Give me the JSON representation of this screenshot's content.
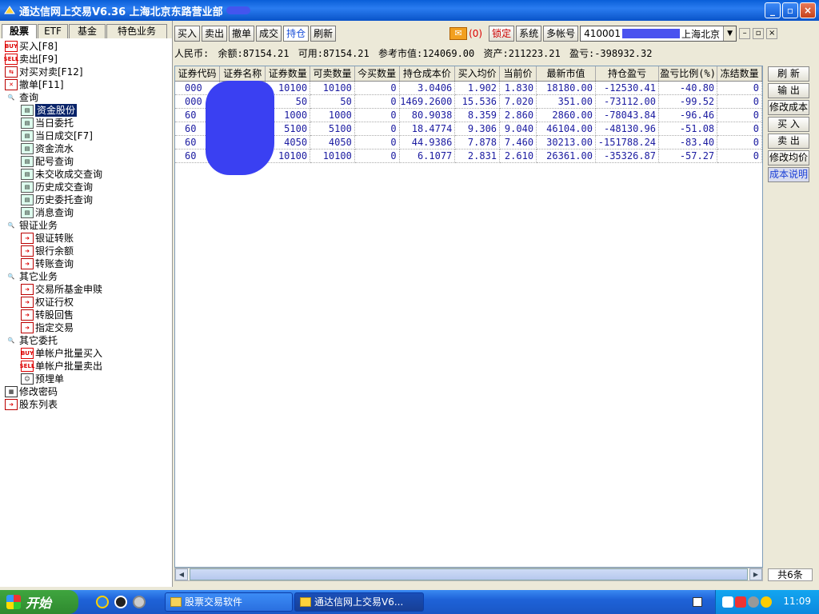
{
  "window": {
    "title": "通达信网上交易V6.36 上海北京东路营业部",
    "min": "_",
    "max": "▫",
    "close": "×"
  },
  "nav": {
    "tabs": [
      "股票",
      "ETF",
      "基金",
      "特色业务"
    ],
    "items": [
      {
        "label": "买入[F8]",
        "icon": "buy-icon",
        "indent": 0
      },
      {
        "label": "卖出[F9]",
        "icon": "sell-icon",
        "indent": 0
      },
      {
        "label": "对买对卖[F12]",
        "icon": "trade-icon",
        "indent": 0
      },
      {
        "label": "撤单[F11]",
        "icon": "cancel-order-icon",
        "indent": 0
      },
      {
        "label": "查询",
        "icon": "search-icon",
        "indent": 0
      },
      {
        "label": "资金股份",
        "icon": "query-icon",
        "indent": 1,
        "selected": true
      },
      {
        "label": "当日委托",
        "icon": "query-icon",
        "indent": 1
      },
      {
        "label": "当日成交[F7]",
        "icon": "query-icon",
        "indent": 1
      },
      {
        "label": "资金流水",
        "icon": "query-icon",
        "indent": 1
      },
      {
        "label": "配号查询",
        "icon": "query-icon",
        "indent": 1
      },
      {
        "label": "未交收成交查询",
        "icon": "query-icon",
        "indent": 1
      },
      {
        "label": "历史成交查询",
        "icon": "query-icon",
        "indent": 1
      },
      {
        "label": "历史委托查询",
        "icon": "query-icon",
        "indent": 1
      },
      {
        "label": "消息查询",
        "icon": "query-icon",
        "indent": 1
      },
      {
        "label": "银证业务",
        "icon": "search-icon",
        "indent": 0
      },
      {
        "label": "银证转账",
        "icon": "arrow-icon",
        "indent": 1
      },
      {
        "label": "银行余额",
        "icon": "arrow-icon",
        "indent": 1
      },
      {
        "label": "转账查询",
        "icon": "arrow-icon",
        "indent": 1
      },
      {
        "label": "其它业务",
        "icon": "search-icon",
        "indent": 0
      },
      {
        "label": "交易所基金申赎",
        "icon": "arrow-icon",
        "indent": 1
      },
      {
        "label": "权证行权",
        "icon": "arrow-icon",
        "indent": 1
      },
      {
        "label": "转股回售",
        "icon": "arrow-icon",
        "indent": 1
      },
      {
        "label": "指定交易",
        "icon": "arrow-icon",
        "indent": 1
      },
      {
        "label": "其它委托",
        "icon": "search-icon",
        "indent": 0
      },
      {
        "label": "单帐户批量买入",
        "icon": "buy-icon",
        "indent": 1
      },
      {
        "label": "单帐户批量卖出",
        "icon": "sell-icon",
        "indent": 1
      },
      {
        "label": "预埋单",
        "icon": "user-icon",
        "indent": 1
      },
      {
        "label": "修改密码",
        "icon": "key-icon",
        "indent": 0
      },
      {
        "label": "股东列表",
        "icon": "arrow-icon",
        "indent": 0
      }
    ]
  },
  "toolbar": {
    "buttons": [
      "买入",
      "卖出",
      "撤单",
      "成交",
      "持仓",
      "刷新"
    ],
    "active": "持仓",
    "mail_count": "(0)",
    "lock": "锁定",
    "system": "系统",
    "multi_account": "多帐号",
    "account_prefix": "410001",
    "account_suffix": "上海北京",
    "account_dd": "▼"
  },
  "summary": {
    "currency": "人民币:",
    "balance": "余额:87154.21",
    "available": "可用:87154.21",
    "market_value": "参考市值:124069.00",
    "assets": "资产:211223.21",
    "pnl": "盈亏:-398932.32"
  },
  "table": {
    "columns": [
      "证券代码",
      "证券名称",
      "证券数量",
      "可卖数量",
      "今买数量",
      "持仓成本价",
      "买入均价",
      "当前价",
      "最新市值",
      "持仓盈亏",
      "盈亏比例(%)",
      "冻结数量"
    ],
    "rows": [
      [
        "000",
        "",
        "10100",
        "10100",
        "0",
        "3.0406",
        "1.902",
        "1.830",
        "18180.00",
        "-12530.41",
        "-40.80",
        "0"
      ],
      [
        "000",
        "",
        "50",
        "50",
        "0",
        "1469.2600",
        "15.536",
        "7.020",
        "351.00",
        "-73112.00",
        "-99.52",
        "0"
      ],
      [
        "60",
        "",
        "1000",
        "1000",
        "0",
        "80.9038",
        "8.359",
        "2.860",
        "2860.00",
        "-78043.84",
        "-96.46",
        "0"
      ],
      [
        "60",
        "",
        "5100",
        "5100",
        "0",
        "18.4774",
        "9.306",
        "9.040",
        "46104.00",
        "-48130.96",
        "-51.08",
        "0"
      ],
      [
        "60",
        "",
        "4050",
        "4050",
        "0",
        "44.9386",
        "7.878",
        "7.460",
        "30213.00",
        "-151788.24",
        "-83.40",
        "0"
      ],
      [
        "60",
        "",
        "10100",
        "10100",
        "0",
        "6.1077",
        "2.831",
        "2.610",
        "26361.00",
        "-35326.87",
        "-57.27",
        "0"
      ]
    ]
  },
  "right_buttons": [
    "刷 新",
    "输 出",
    "修改成本",
    "买 入",
    "卖 出",
    "修改均价",
    "成本说明"
  ],
  "row_count": "共6条",
  "taskbar": {
    "start": "开始",
    "tasks": [
      "股票交易软件",
      "通达信网上交易V6..."
    ],
    "clock": "11:09"
  }
}
